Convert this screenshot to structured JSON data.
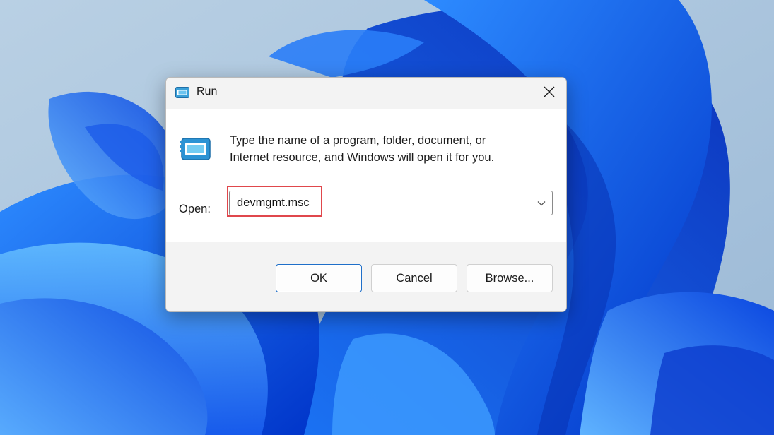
{
  "dialog": {
    "title": "Run",
    "description_line1": "Type the name of a program, folder, document, or",
    "description_line2": "Internet resource, and Windows will open it for you.",
    "open_label": "Open:",
    "open_value": "devmgmt.msc",
    "buttons": {
      "ok": "OK",
      "cancel": "Cancel",
      "browse": "Browse..."
    }
  },
  "icons": {
    "title": "run-icon",
    "program": "program-window-icon",
    "close": "close-icon",
    "dropdown": "chevron-down-icon"
  },
  "colors": {
    "highlight": "#e0474c",
    "accent": "#1f6fc9",
    "wallpaper_blue": "#0a57e8"
  }
}
